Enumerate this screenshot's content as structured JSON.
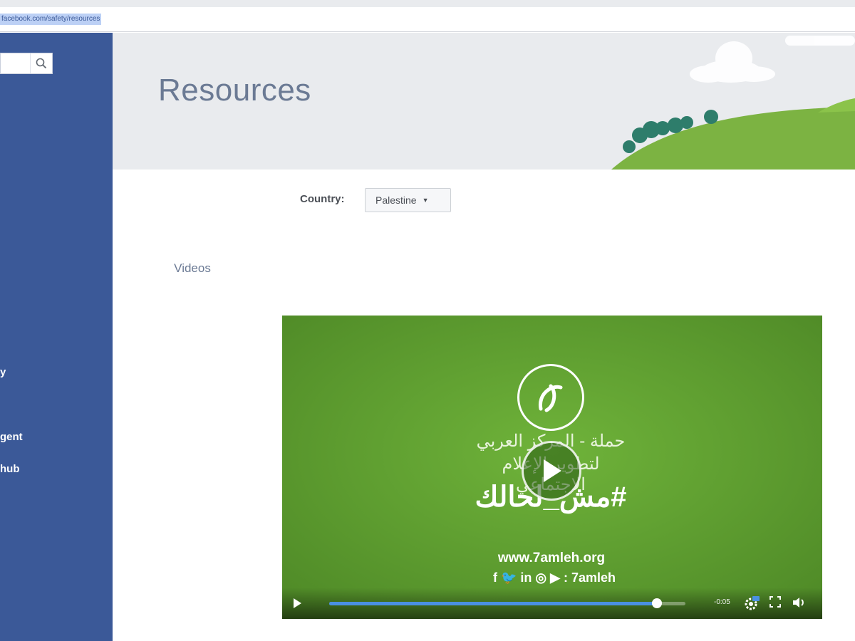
{
  "browser": {
    "url": "facebook.com/safety/resources"
  },
  "sidebar": {
    "search_placeholder": "",
    "items": [
      {
        "label": "y"
      },
      {
        "label": "gent"
      },
      {
        "label": "hub"
      }
    ]
  },
  "header": {
    "title": "Resources"
  },
  "filters": {
    "country_label": "Country:",
    "country_value": "Palestine"
  },
  "tabs": [
    {
      "label": "Videos"
    }
  ],
  "video": {
    "arabic_line1": "حملة - المركز العربي",
    "arabic_line2": "لتطوير الإعلام الاجتماعي",
    "hashtag": "#مش_لحالك",
    "site_url": "www.7amleh.org",
    "social_handle": "f  🐦  in  ◎  ▶ : 7amleh",
    "time": "-0:05",
    "progress": 0.92
  },
  "colors": {
    "sidebar": "#3b5998",
    "banner": "#e9ebee",
    "video_green": "#5e9c30",
    "progress": "#4a90e2"
  }
}
